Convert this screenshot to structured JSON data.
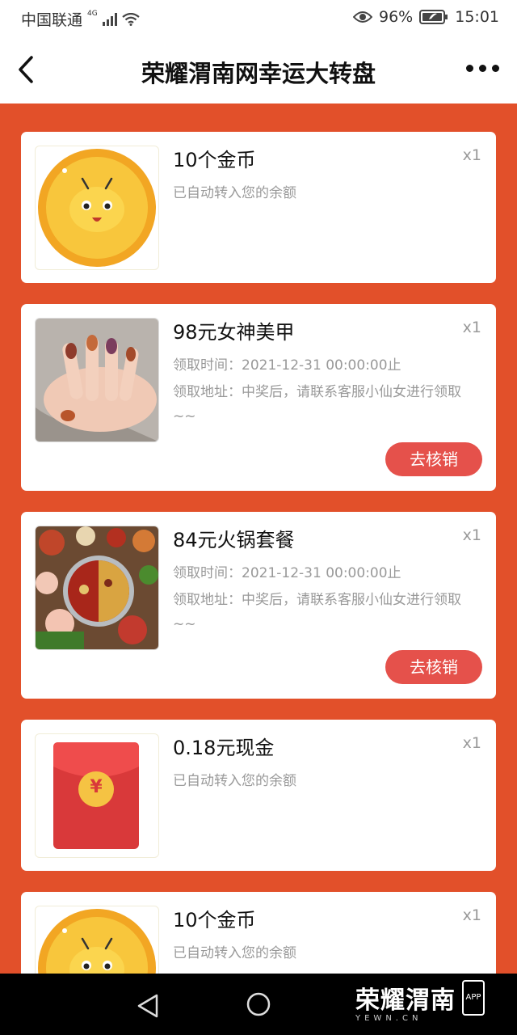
{
  "status": {
    "carrier": "中国联通",
    "network": "4G",
    "battery": "96%",
    "time": "15:01"
  },
  "header": {
    "title": "荣耀渭南网幸运大转盘"
  },
  "prizes": [
    {
      "title": "10个金币",
      "qty": "x1",
      "desc": "已自动转入您的余额",
      "thumb": "gold-coin-icon"
    },
    {
      "title": "98元女神美甲",
      "qty": "x1",
      "time_label": "领取时间：",
      "time": "2021-12-31 00:00:00止",
      "address_label": "领取地址：",
      "address": "中奖后，请联系客服小仙女进行领取~~",
      "button": "去核销",
      "thumb": "manicure-photo"
    },
    {
      "title": "84元火锅套餐",
      "qty": "x1",
      "time_label": "领取时间：",
      "time": "2021-12-31 00:00:00止",
      "address_label": "领取地址：",
      "address": "中奖后，请联系客服小仙女进行领取~~",
      "button": "去核销",
      "thumb": "hotpot-photo"
    },
    {
      "title": "0.18元现金",
      "qty": "x1",
      "desc": "已自动转入您的余额",
      "thumb": "red-envelope-icon",
      "yuan_symbol": "¥"
    },
    {
      "title": "10个金币",
      "qty": "x1",
      "desc": "已自动转入您的余额",
      "thumb": "gold-coin-icon"
    }
  ],
  "watermark": {
    "main": "荣耀渭南",
    "sub": "YEWN.CN",
    "app": "APP"
  },
  "colors": {
    "background": "#e2502a",
    "button": "#e5514b",
    "card": "#ffffff"
  }
}
